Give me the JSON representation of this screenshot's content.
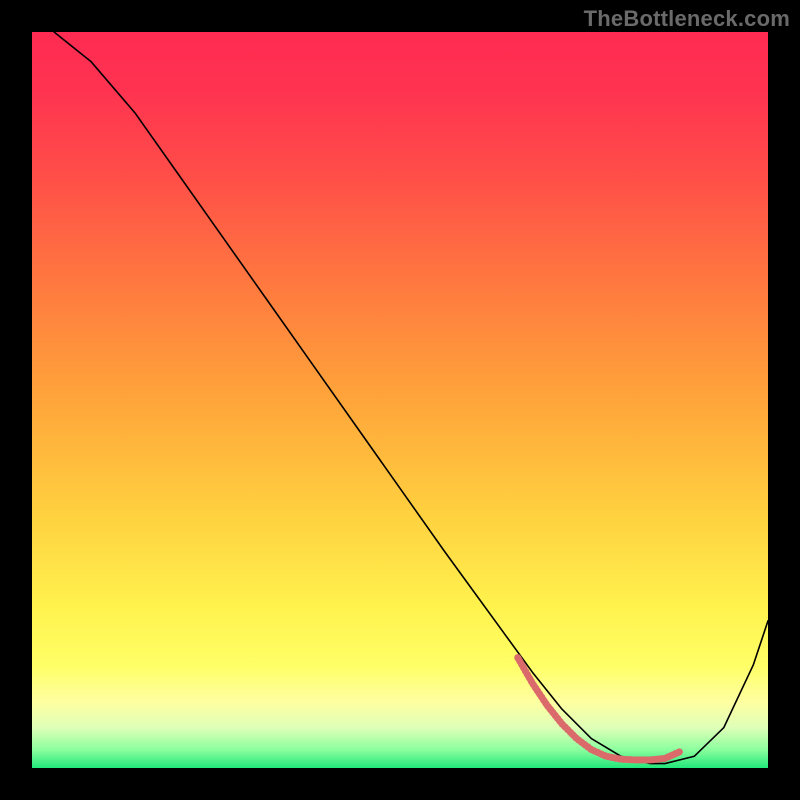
{
  "watermark": "TheBottleneck.com",
  "gradient_stops": [
    {
      "offset": 0.0,
      "color": "#ff2b52"
    },
    {
      "offset": 0.08,
      "color": "#ff3350"
    },
    {
      "offset": 0.2,
      "color": "#ff4f48"
    },
    {
      "offset": 0.35,
      "color": "#ff7b3f"
    },
    {
      "offset": 0.5,
      "color": "#ffa53a"
    },
    {
      "offset": 0.65,
      "color": "#ffcf3f"
    },
    {
      "offset": 0.78,
      "color": "#fff24d"
    },
    {
      "offset": 0.86,
      "color": "#ffff66"
    },
    {
      "offset": 0.91,
      "color": "#feffa0"
    },
    {
      "offset": 0.945,
      "color": "#dfffb8"
    },
    {
      "offset": 0.975,
      "color": "#8cff9e"
    },
    {
      "offset": 1.0,
      "color": "#21e77a"
    }
  ],
  "chart_data": {
    "type": "line",
    "title": "",
    "xlabel": "",
    "ylabel": "",
    "xlim": [
      0,
      100
    ],
    "ylim": [
      0,
      100
    ],
    "series": [
      {
        "name": "bottleneck-curve",
        "x": [
          3,
          8,
          14,
          20,
          26,
          32,
          38,
          44,
          50,
          56,
          60,
          64,
          68,
          72,
          76,
          80,
          84,
          86,
          90,
          94,
          98,
          100
        ],
        "y": [
          100,
          96,
          89,
          80.5,
          72,
          63.5,
          55,
          46.5,
          38,
          29.5,
          24,
          18.5,
          13,
          8,
          4,
          1.6,
          0.6,
          0.6,
          1.6,
          5.5,
          14,
          20
        ]
      },
      {
        "name": "optimal-band-marker",
        "x": [
          66,
          68,
          70,
          72,
          74,
          76,
          78,
          80,
          82,
          84,
          86,
          88
        ],
        "y": [
          15,
          11.5,
          8.5,
          6,
          4,
          2.5,
          1.6,
          1.2,
          1.1,
          1.1,
          1.3,
          2.2
        ]
      }
    ],
    "marker_color": "#db6b6b",
    "curve_color": "#000000"
  }
}
